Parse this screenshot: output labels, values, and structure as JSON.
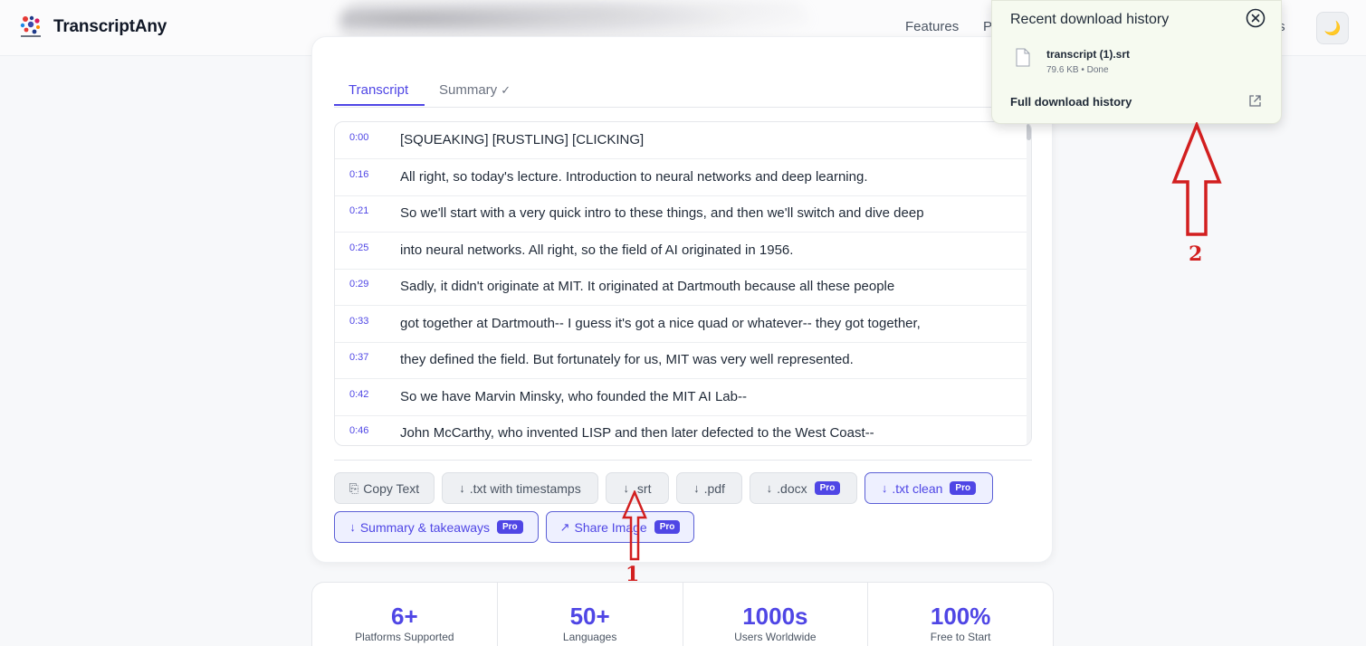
{
  "header": {
    "brand": "TranscriptAny",
    "nav": {
      "features": "Features",
      "p_partial": "P",
      "ts_partial": "ts"
    },
    "theme_icon": "moon-icon"
  },
  "tabs": {
    "transcript": "Transcript",
    "summary": "Summary",
    "summary_check": "✓"
  },
  "transcript_rows": [
    {
      "time": "0:00",
      "text": "[SQUEAKING] [RUSTLING] [CLICKING]"
    },
    {
      "time": "0:16",
      "text": "All right, so today's lecture. Introduction to neural networks and deep learning."
    },
    {
      "time": "0:21",
      "text": "So we'll start with a very quick intro to these things, and then we'll switch and dive deep"
    },
    {
      "time": "0:25",
      "text": "into neural networks. All right, so the field of AI originated in 1956."
    },
    {
      "time": "0:29",
      "text": "Sadly, it didn't originate at MIT. It originated at Dartmouth because all these people"
    },
    {
      "time": "0:33",
      "text": "got together at Dartmouth-- I guess it's got a nice quad or whatever-- they got together,"
    },
    {
      "time": "0:37",
      "text": "they defined the field. But fortunately for us, MIT was very well represented."
    },
    {
      "time": "0:42",
      "text": "So we have Marvin Minsky, who founded the MIT AI Lab--"
    },
    {
      "time": "0:46",
      "text": "John McCarthy, who invented LISP and then later defected to the West Coast--"
    }
  ],
  "actions": {
    "copy_text": "Copy Text",
    "txt_timestamps": ".txt with timestamps",
    "srt": ".srt",
    "pdf": ".pdf",
    "docx": ".docx",
    "txt_clean": ".txt clean",
    "summary_takeaways": "Summary & takeaways",
    "share_image": "Share Image",
    "pro_badge": "Pro",
    "download_glyph": "↓",
    "share_glyph": "↗",
    "copy_glyph": "⎘"
  },
  "stats": [
    {
      "value": "6+",
      "label": "Platforms Supported"
    },
    {
      "value": "50+",
      "label": "Languages"
    },
    {
      "value": "1000s",
      "label": "Users Worldwide"
    },
    {
      "value": "100%",
      "label": "Free to Start"
    }
  ],
  "download_popup": {
    "title": "Recent download history",
    "file_name": "transcript (1).srt",
    "file_meta": "79.6 KB • Done",
    "full_history": "Full download history"
  },
  "annotations": {
    "label_1": "1",
    "label_2": "2",
    "color": "#d21f1f"
  },
  "colors": {
    "accent": "#4f46e5",
    "popup_bg": "#f6faf0"
  }
}
